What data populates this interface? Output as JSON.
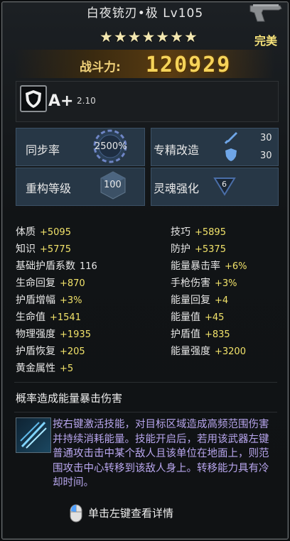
{
  "header": {
    "title": "白夜铳刃•极 Lv105",
    "stars": "★★★★★★★",
    "star_count": 7,
    "quality": "完美",
    "weapon_icon": "pistol-icon"
  },
  "combat": {
    "label": "战斗力:",
    "value": "120929"
  },
  "rank": {
    "badge_icon": "shield-icon",
    "grade": "A+",
    "multiplier": "2.10"
  },
  "attributes": {
    "sync_rate_label": "同步率",
    "sync_rate_value": "2500%",
    "specialize_label": "专精改造",
    "specialize_attack": "30",
    "specialize_shield": "30",
    "rebuild_label": "重构等级",
    "rebuild_value": "100",
    "soul_label": "灵魂强化",
    "soul_value": "6"
  },
  "stats_left": [
    {
      "name": "体质",
      "value": "+5095"
    },
    {
      "name": "知识",
      "value": "+5775"
    },
    {
      "name": "基础护盾系数",
      "value": "116"
    },
    {
      "name": "生命回复",
      "value": "+870"
    },
    {
      "name": "护盾增幅",
      "value": "+3%"
    },
    {
      "name": "生命值",
      "value": "+1541"
    },
    {
      "name": "物理强度",
      "value": "+1935"
    },
    {
      "name": "护盾恢复",
      "value": "+205"
    },
    {
      "name": "黄金属性",
      "value": "+5"
    }
  ],
  "stats_right": [
    {
      "name": "技巧",
      "value": "+5895"
    },
    {
      "name": "防护",
      "value": "+5375"
    },
    {
      "name": "能量暴击率",
      "value": "+6%"
    },
    {
      "name": "手枪伤害",
      "value": "+3%"
    },
    {
      "name": "能量回复",
      "value": "+4"
    },
    {
      "name": "能量值",
      "value": "+45"
    },
    {
      "name": "护盾值",
      "value": "+835"
    },
    {
      "name": "能量强度",
      "value": "+3200"
    }
  ],
  "effect": {
    "title": "概率造成能量暴击伤害"
  },
  "skill": {
    "icon": "claw-slash-icon",
    "description": "按右键激活技能，对目标区域造成高频范围伤害并持续消耗能量。技能开启后，若用该武器左键普通攻击击中某个敌人且该单位在地面上，则范围攻击中心转移到该敌人身上。转移能力具有冷却时间。"
  },
  "footer": {
    "hint_icon": "mouse-icon",
    "hint": "单击左键查看详情"
  },
  "colors": {
    "stat_value": "#f2e36a",
    "quality": "#f6e27a",
    "skill_text": "#b8a6ee",
    "cell_bg": "#273746"
  }
}
